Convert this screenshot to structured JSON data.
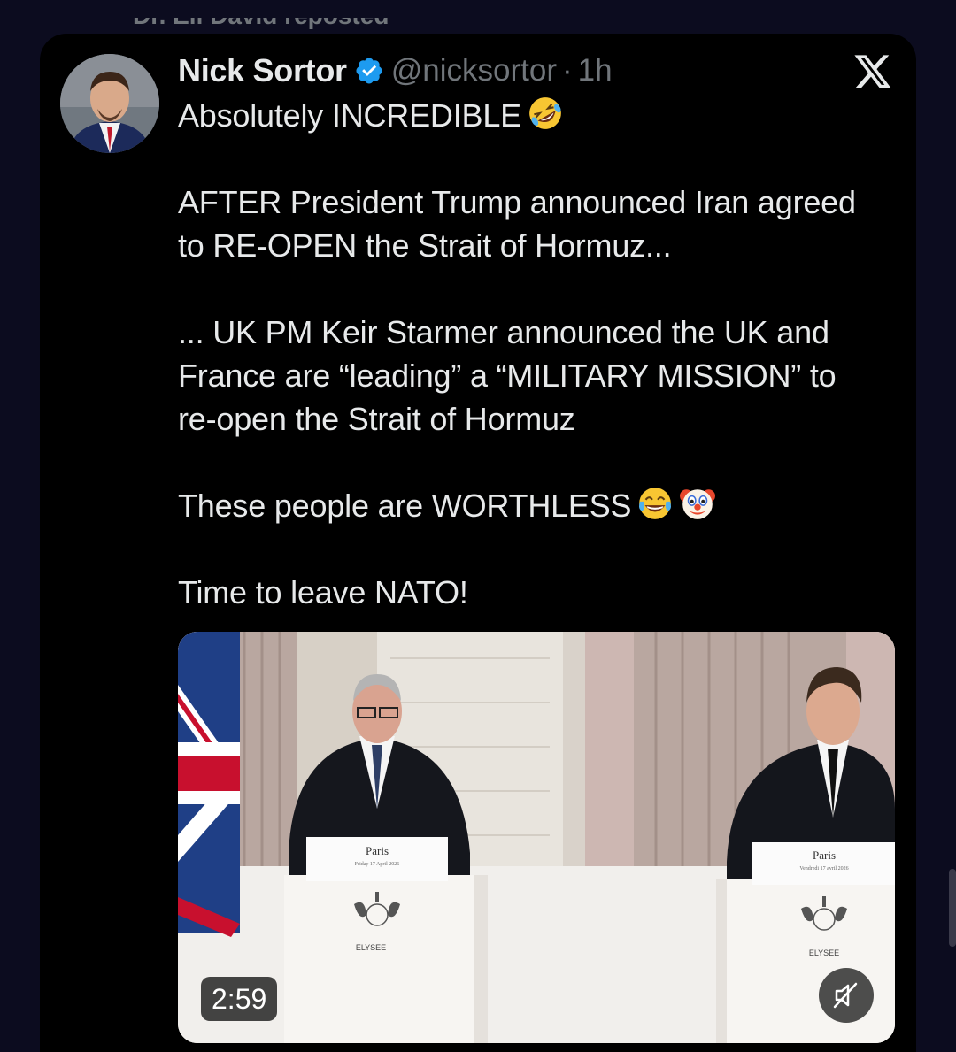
{
  "repost": {
    "text": "Dr. Eli David reposted"
  },
  "tweet": {
    "author": {
      "display_name": "Nick Sortor",
      "handle": "@nicksortor",
      "verified": true
    },
    "separator": "·",
    "time": "1h",
    "lines": [
      "Absolutely INCREDIBLE",
      "",
      "AFTER President Trump announced Iran agreed",
      "to RE-OPEN the Strait of Hormuz...",
      "",
      "... UK PM Keir Starmer announced the UK and",
      "France are “leading” a “MILITARY MISSION” to",
      "re-open the Strait of Hormuz",
      "",
      "These people are WORTHLESS",
      "",
      "Time to leave NATO!"
    ],
    "emojis": {
      "line_0": [
        "rolling-on-floor-laughing-emoji"
      ],
      "line_9": [
        "tears-of-joy-emoji",
        "clown-face-emoji"
      ]
    },
    "media": {
      "type": "video",
      "duration": "2:59",
      "muted": true,
      "podium_left": {
        "city": "Paris",
        "date": "Friday 17 April 2026",
        "brand": "ELYSEE"
      },
      "podium_right": {
        "city": "Paris",
        "date": "Vendredi 17 avril 2026",
        "brand": "ELYSEE"
      }
    }
  },
  "platform": {
    "logo": "x-logo-icon"
  },
  "colors": {
    "background": "#000000",
    "page": "#0c0c1f",
    "text_primary": "#e7e9ea",
    "text_secondary": "#71767b",
    "verified_badge": "#1d9bf0"
  }
}
